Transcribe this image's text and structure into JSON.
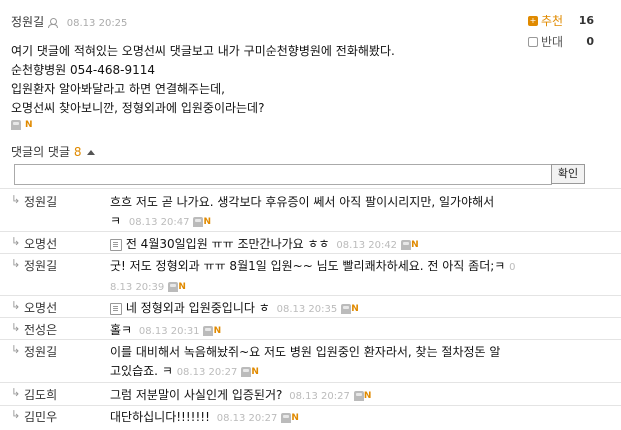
{
  "comment": {
    "author": "정원길",
    "date": "08.13 20:25",
    "lines": [
      "여기 댓글에 적혀있는 오명선씨 댓글보고 내가 구미순천향병원에 전화해봤다.",
      "순천향병원 054-468-9114",
      "입원환자 알아봐달라고 하면 연결해주는데,",
      "오명선씨 찾아보니깐, 정형외과에 입원중이라는데?"
    ],
    "vote_up_label": "추천",
    "vote_up_count": "16",
    "vote_down_label": "반대",
    "vote_down_count": "0"
  },
  "replies_header": {
    "label": "댓글의 댓글",
    "count": "8",
    "toggle_icon": "caret-up-icon"
  },
  "reply_form": {
    "input_value": "",
    "submit_label": "확인"
  },
  "replies": [
    {
      "author": "정원길",
      "text": "흐흐 저도 곧 나가요. 생각보다 후유증이 쎄서 아직 팔이시리지만, 일가야해서",
      "text2": "ㅋ",
      "date": "08.13 20:47"
    },
    {
      "author": "오명선",
      "text": "전 4월30일입원 ㅠㅠ 조만간나가요 ㅎㅎ",
      "date": "08.13 20:42"
    },
    {
      "author": "정원길",
      "text": "굿! 저도 정형외과 ㅠㅠ 8월1일 입원~~ 님도 빨리쾌차하세요. 전 아직 좀더;ㅋ",
      "text_suffix": "0",
      "date_line": "8.13 20:39"
    },
    {
      "author": "오명선",
      "text": "네 정형외과 입원중입니다 ㅎ",
      "date": "08.13 20:35"
    },
    {
      "author": "전성은",
      "text": "홀ㅋ",
      "date": "08.13 20:31"
    },
    {
      "author": "정원길",
      "text": "이를 대비해서 녹음해놨쥐~요 저도 병원 입원중인 환자라서, 찾는 절차정돈 알",
      "text2": "고있습죠.",
      "text3": "ㅋ",
      "date": "08.13 20:27"
    },
    {
      "author": "김도희",
      "text": "그럼 저분말이 사실인게 입증된거?",
      "date": "08.13 20:27"
    },
    {
      "author": "김민우",
      "text": "대단하십니다!!!!!!!",
      "date": "08.13 20:27"
    }
  ]
}
